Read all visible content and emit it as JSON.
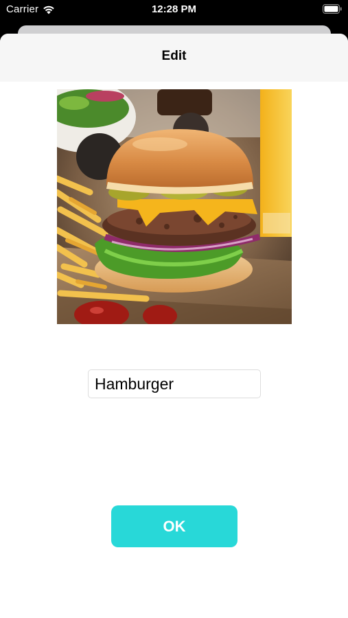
{
  "status_bar": {
    "carrier": "Carrier",
    "time": "12:28 PM",
    "wifi_icon": "wifi-icon",
    "battery_icon": "battery-icon"
  },
  "nav": {
    "title": "Edit"
  },
  "food": {
    "name_value": "Hamburger"
  },
  "actions": {
    "ok_label": "OK"
  },
  "colors": {
    "accent": "#28d8d8",
    "nav_background": "#f6f6f6"
  }
}
